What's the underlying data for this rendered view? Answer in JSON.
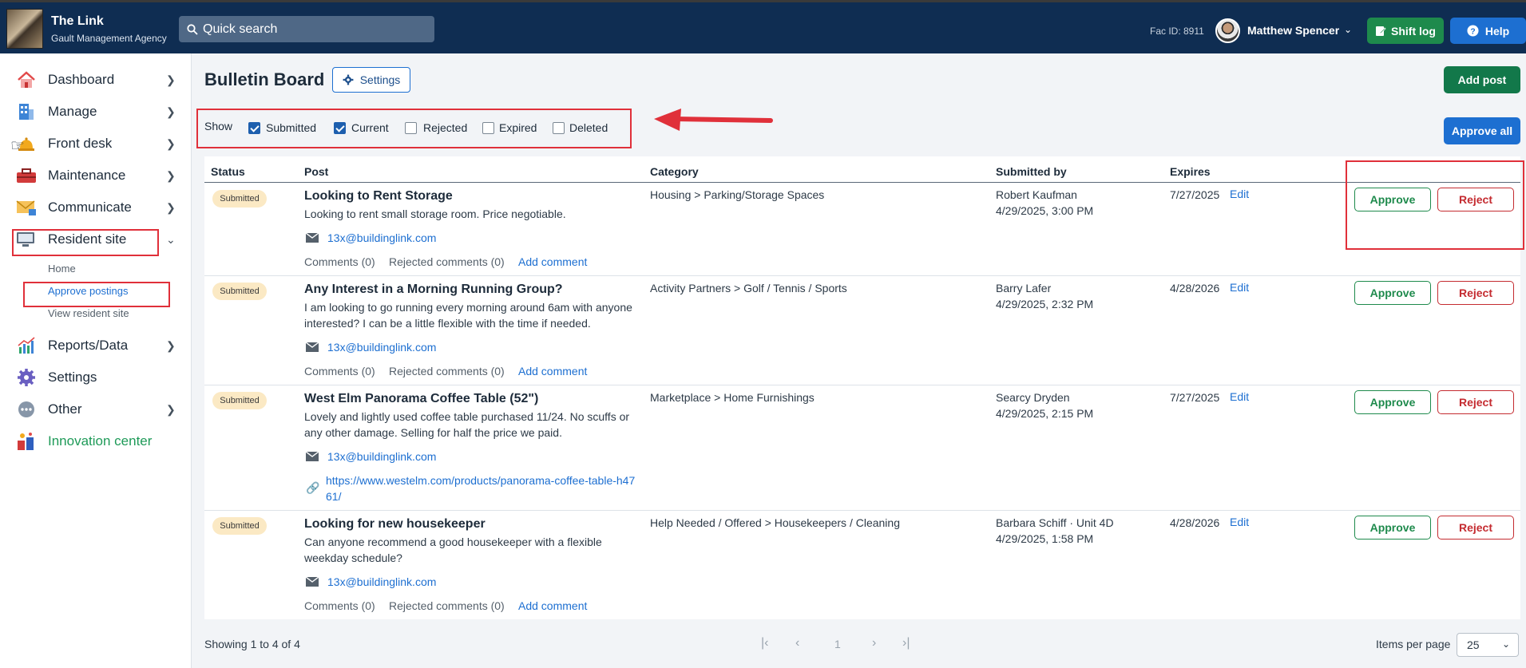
{
  "header": {
    "brand_title": "The Link",
    "brand_subtitle": "Gault Management Agency",
    "search_placeholder": "Quick search",
    "fac_id": "Fac ID: 8911",
    "user_name": "Matthew Spencer",
    "shift_log": "Shift log",
    "help": "Help"
  },
  "sidebar": {
    "items": [
      {
        "label": "Dashboard",
        "icon": "house-icon"
      },
      {
        "label": "Manage",
        "icon": "building-icon"
      },
      {
        "label": "Front desk",
        "icon": "bell-icon"
      },
      {
        "label": "Maintenance",
        "icon": "toolbox-icon"
      },
      {
        "label": "Communicate",
        "icon": "envelope-icon"
      },
      {
        "label": "Resident site",
        "icon": "monitor-icon"
      },
      {
        "label": "Reports/Data",
        "icon": "chart-icon"
      },
      {
        "label": "Settings",
        "icon": "gear-icon"
      },
      {
        "label": "Other",
        "icon": "ellipsis-icon"
      },
      {
        "label": "Innovation center",
        "icon": "flask-icon"
      }
    ],
    "sub_items": [
      "Home",
      "Approve postings",
      "View resident site"
    ]
  },
  "page": {
    "title": "Bulletin Board",
    "settings": "Settings",
    "add_post": "Add post",
    "approve_all": "Approve all",
    "show_label": "Show",
    "filters": [
      {
        "label": "Submitted",
        "checked": true
      },
      {
        "label": "Current",
        "checked": true
      },
      {
        "label": "Rejected",
        "checked": false
      },
      {
        "label": "Expired",
        "checked": false
      },
      {
        "label": "Deleted",
        "checked": false
      }
    ]
  },
  "table": {
    "columns": [
      "Status",
      "Post",
      "Category",
      "Submitted by",
      "Expires"
    ],
    "approve_label": "Approve",
    "reject_label": "Reject",
    "edit_label": "Edit",
    "comments_label": "Comments (0)",
    "rejected_comments_label": "Rejected comments (0)",
    "add_comment_label": "Add comment",
    "rows": [
      {
        "status": "Submitted",
        "title": "Looking to Rent Storage",
        "body": "Looking to rent small storage room. Price negotiable.",
        "email": "13x@buildinglink.com",
        "link": "",
        "category": "Housing > Parking/Storage Spaces",
        "submitted_by": "Robert Kaufman",
        "submitted_at": "4/29/2025, 3:00 PM",
        "expires": "7/27/2025"
      },
      {
        "status": "Submitted",
        "title": "Any Interest in a Morning Running Group?",
        "body": "I am looking to go running every morning around 6am with anyone interested? I can be a little flexible with the time if needed.",
        "email": "13x@buildinglink.com",
        "link": "",
        "category": "Activity Partners > Golf / Tennis / Sports",
        "submitted_by": "Barry Lafer",
        "submitted_at": "4/29/2025, 2:32 PM",
        "expires": "4/28/2026"
      },
      {
        "status": "Submitted",
        "title": "West Elm Panorama Coffee Table (52\")",
        "body": "Lovely and lightly used coffee table purchased 11/24. No scuffs or any other damage. Selling for half the price we paid.",
        "email": "13x@buildinglink.com",
        "link": "https://www.westelm.com/products/panorama-coffee-table-h4761/",
        "category": "Marketplace > Home Furnishings",
        "submitted_by": "Searcy Dryden",
        "submitted_at": "4/29/2025, 2:15 PM",
        "expires": "7/27/2025"
      },
      {
        "status": "Submitted",
        "title": "Looking for new housekeeper",
        "body": "Can anyone recommend a good housekeeper with a flexible weekday schedule?",
        "email": "13x@buildinglink.com",
        "link": "",
        "category": "Help Needed / Offered > Housekeepers / Cleaning",
        "submitted_by": "Barbara Schiff · Unit 4D",
        "submitted_at": "4/29/2025, 1:58 PM",
        "expires": "4/28/2026"
      }
    ]
  },
  "footer": {
    "showing": "Showing 1 to 4 of 4",
    "page_number": "1",
    "items_per_page_label": "Items per page",
    "items_per_page_value": "25"
  },
  "colors": {
    "header_bg": "#0f2d52",
    "accent_blue": "#1d6fd1",
    "approve_green": "#1e8a4c",
    "reject_red": "#c42b30",
    "annotation_red": "#e0303a"
  }
}
